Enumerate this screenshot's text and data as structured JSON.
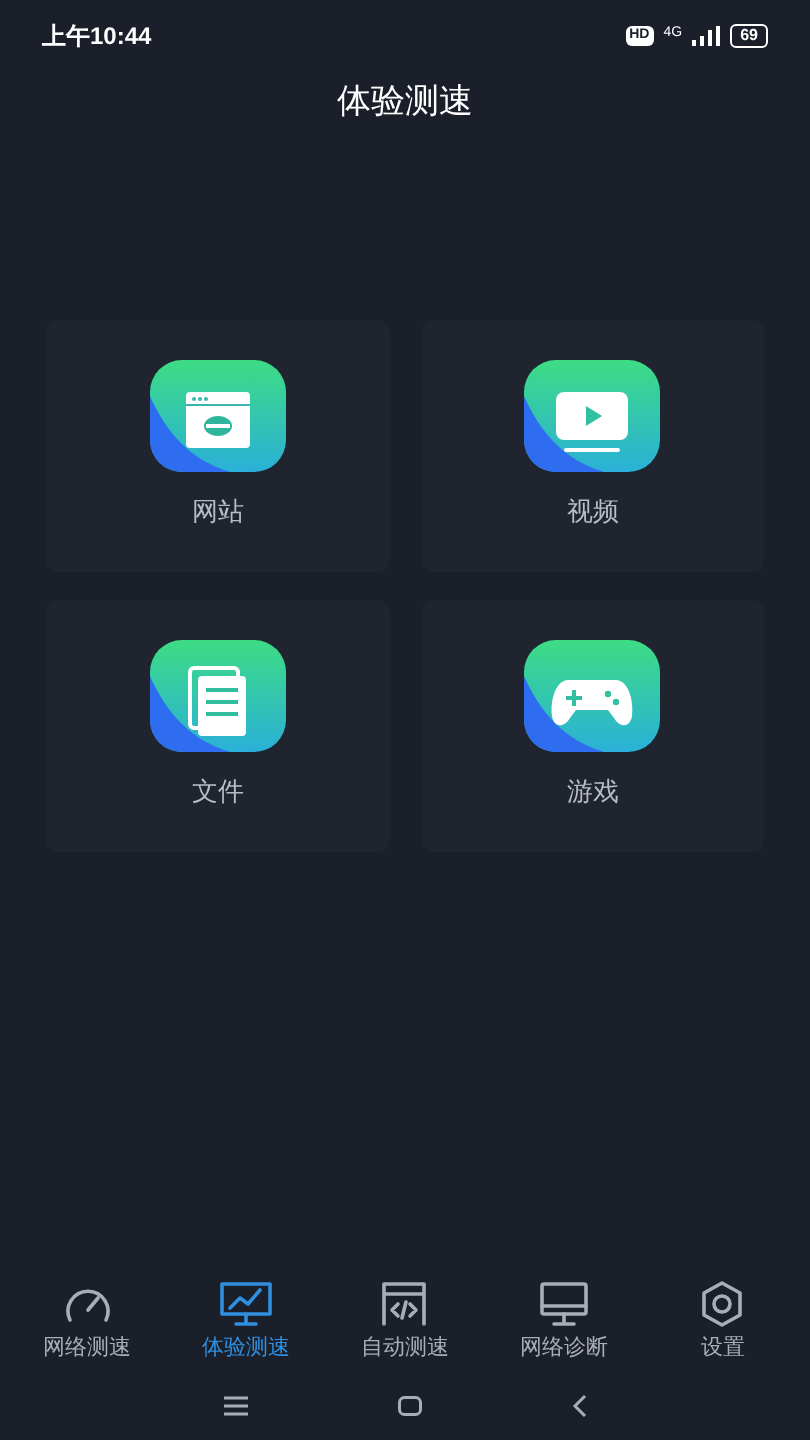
{
  "status_bar": {
    "time": "上午10:44",
    "hd": "HD",
    "network": "4G",
    "battery": "69"
  },
  "title": "体验测速",
  "tiles": [
    {
      "kind": "website",
      "label": "网站"
    },
    {
      "kind": "video",
      "label": "视频"
    },
    {
      "kind": "file",
      "label": "文件"
    },
    {
      "kind": "game",
      "label": "游戏"
    }
  ],
  "nav": [
    {
      "kind": "speed",
      "label": "网络测速",
      "selected": false
    },
    {
      "kind": "experience",
      "label": "体验测速",
      "selected": true
    },
    {
      "kind": "auto",
      "label": "自动测速",
      "selected": false
    },
    {
      "kind": "diagnose",
      "label": "网络诊断",
      "selected": false
    },
    {
      "kind": "settings",
      "label": "设置",
      "selected": false
    }
  ]
}
